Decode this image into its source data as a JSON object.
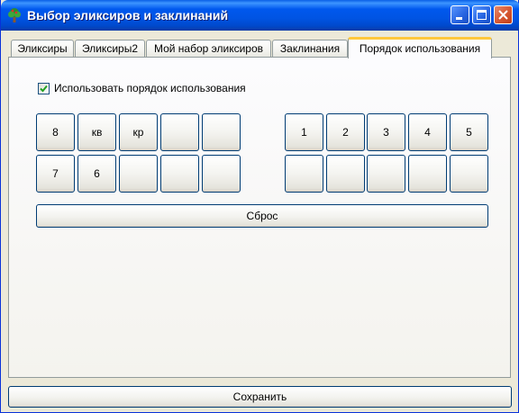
{
  "window": {
    "title": "Выбор эликсиров и заклинаний"
  },
  "tabs": [
    {
      "label": "Эликсиры",
      "active": false
    },
    {
      "label": "Эликсиры2",
      "active": false
    },
    {
      "label": "Мой набор эликсиров",
      "active": false
    },
    {
      "label": "Заклинания",
      "active": false
    },
    {
      "label": "Порядок использования",
      "active": true
    }
  ],
  "order_tab": {
    "use_order_checkbox": {
      "label": "Использовать порядок использования",
      "checked": true
    },
    "left_grid": {
      "row1": [
        "8",
        "кв",
        "кр",
        "",
        ""
      ],
      "row2": [
        "7",
        "6",
        "",
        "",
        ""
      ]
    },
    "right_grid": {
      "row1": [
        "1",
        "2",
        "3",
        "4",
        "5"
      ],
      "row2": [
        "",
        "",
        "",
        "",
        ""
      ]
    },
    "reset_label": "Сброс"
  },
  "footer": {
    "save_label": "Сохранить"
  },
  "colors": {
    "titlebar": "#0054E3",
    "window_bg": "#ECE9D8",
    "active_tab_accent": "#FFC83C",
    "button_border": "#003C74"
  },
  "icons": {
    "app": "tree-icon",
    "minimize": "minimize-icon",
    "maximize": "maximize-icon",
    "close": "close-icon",
    "check": "checkmark-icon"
  }
}
